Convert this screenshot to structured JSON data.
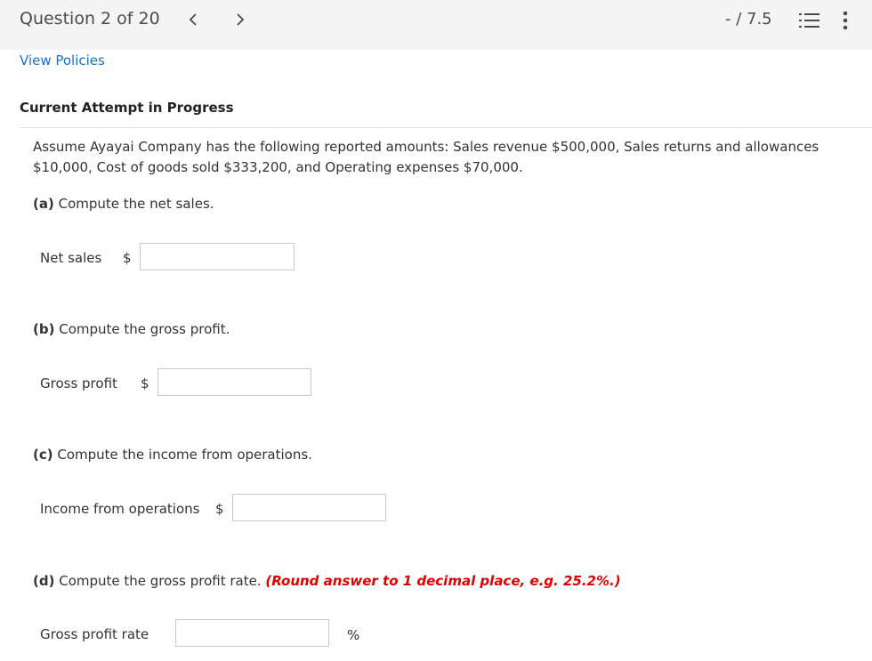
{
  "header": {
    "question_counter": "Question 2 of 20",
    "score": "- / 7.5",
    "prev_glyph": "<",
    "next_glyph": ">"
  },
  "links": {
    "view_policies": "View Policies"
  },
  "attempt_label": "Current Attempt in Progress",
  "prompt": "Assume Ayayai Company has the following reported amounts: Sales revenue $500,000, Sales returns and allowances $10,000, Cost of goods sold $333,200, and Operating expenses $70,000.",
  "parts": {
    "a": {
      "letter": "(a)",
      "text": " Compute the net sales.",
      "field_label": "Net sales",
      "unit": "$",
      "value": "",
      "placeholder": ""
    },
    "b": {
      "letter": "(b)",
      "text": " Compute the gross profit.",
      "field_label": "Gross profit",
      "unit": "$",
      "value": "",
      "placeholder": ""
    },
    "c": {
      "letter": "(c)",
      "text": " Compute the income from operations.",
      "field_label": "Income from operations",
      "unit": "$",
      "value": "",
      "placeholder": ""
    },
    "d": {
      "letter": "(d)",
      "text": " Compute the gross profit rate. ",
      "hint": "(Round answer to 1 decimal place, e.g. 25.2%.)",
      "field_label": "Gross profit rate",
      "unit": "%",
      "value": "",
      "placeholder": ""
    }
  },
  "icons": {
    "prev": "chevron-left-icon",
    "next": "chevron-right-icon",
    "list": "numbered-list-icon",
    "more": "more-vertical-icon"
  },
  "colors": {
    "link": "#1a73c9",
    "hint": "#e10000",
    "header_bg": "#f4f4f4",
    "input_border": "#c9c9c9"
  }
}
